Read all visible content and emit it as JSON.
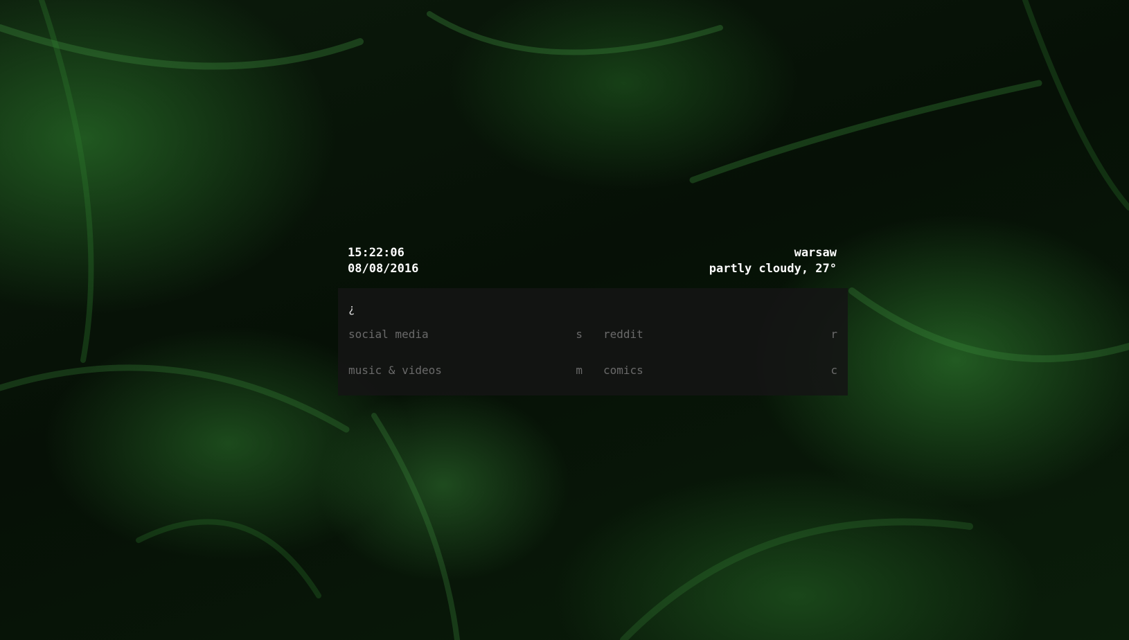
{
  "clock": {
    "time": "15:22:06",
    "date": "08/08/2016"
  },
  "weather": {
    "city": "warsaw",
    "condition": "partly cloudy, 27°"
  },
  "prompt": {
    "glyph": "¿"
  },
  "columns": [
    {
      "items": [
        {
          "label": "social media",
          "key": "s"
        },
        {
          "label": "music & videos",
          "key": "m"
        }
      ]
    },
    {
      "items": [
        {
          "label": "reddit",
          "key": "r"
        },
        {
          "label": "comics",
          "key": "c"
        }
      ]
    }
  ],
  "colors": {
    "text_primary": "#ffffff",
    "text_muted": "#6a6a6a",
    "panel_bg": "#141414",
    "background_accent": "#2e7a2e"
  }
}
